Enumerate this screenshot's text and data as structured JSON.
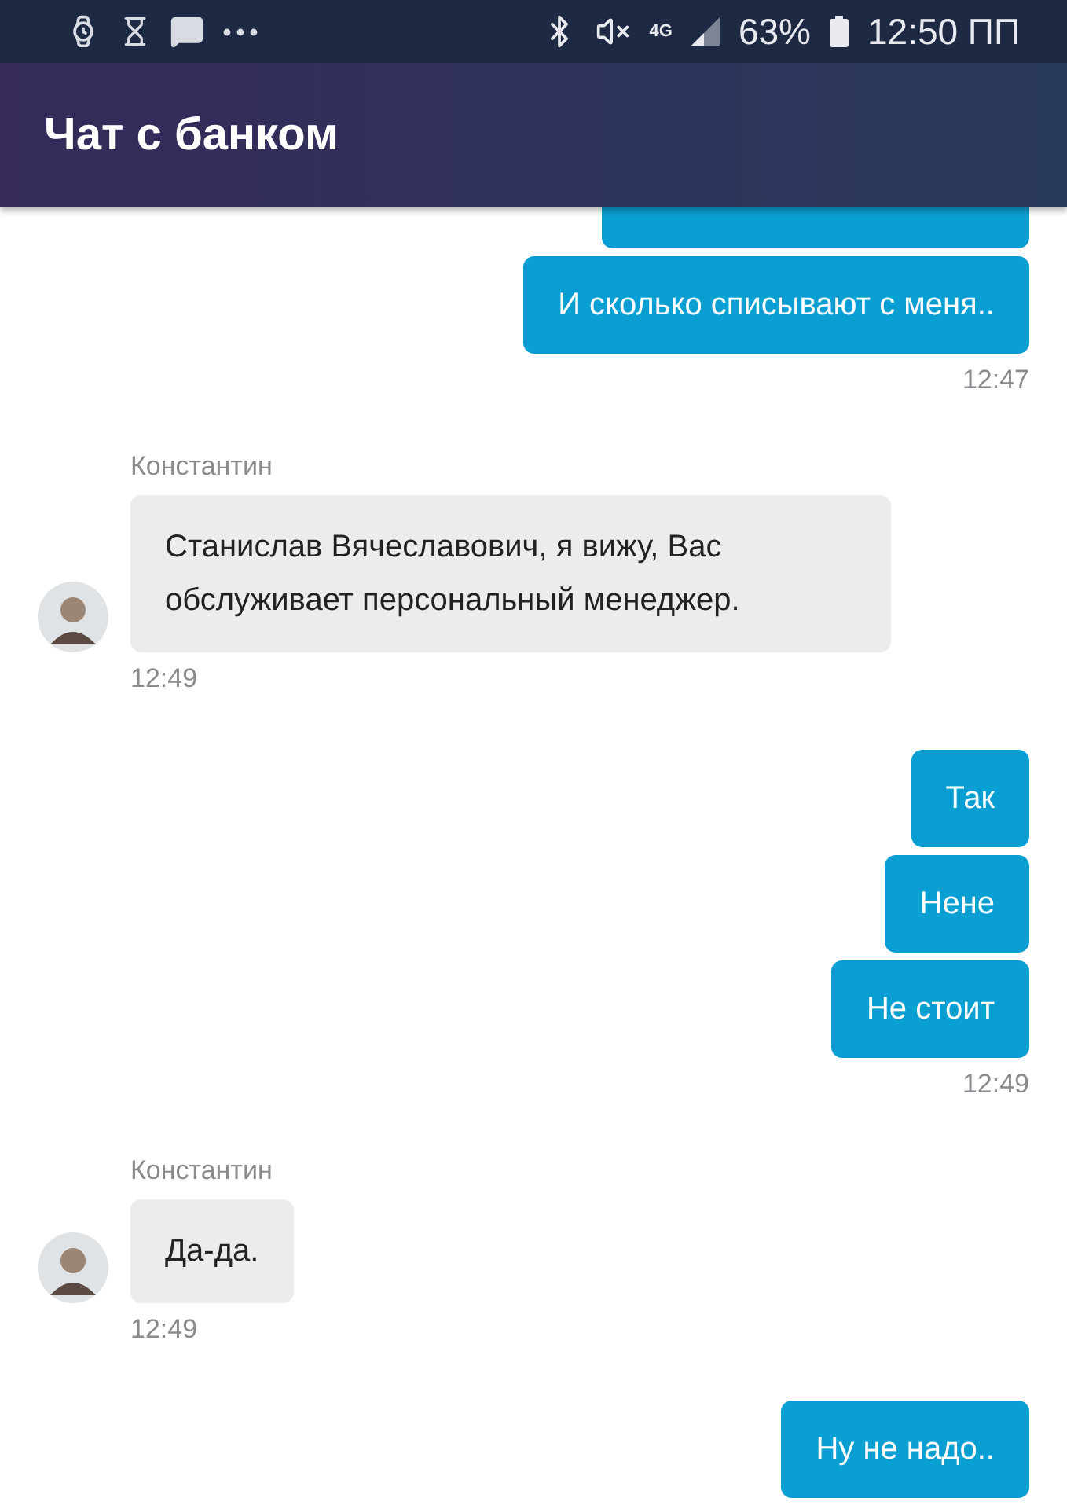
{
  "status_bar": {
    "network": "4G",
    "battery": "63%",
    "time": "12:50 ПП"
  },
  "title": "Чат с банком",
  "messages": [
    {
      "kind": "outgoing",
      "clipped_bubble": true,
      "bubbles": [
        "И сколько списывают с меня.."
      ],
      "time": "12:47"
    },
    {
      "kind": "incoming",
      "sender": "Константин",
      "bubbles": [
        "Станислав Вячеславович, я вижу, Вас обслуживает персональный менеджер."
      ],
      "time": "12:49"
    },
    {
      "kind": "outgoing",
      "bubbles": [
        "Так",
        "Нене",
        "Не стоит"
      ],
      "time": "12:49"
    },
    {
      "kind": "incoming",
      "sender": "Константин",
      "bubbles": [
        "Да-да."
      ],
      "time": "12:49"
    },
    {
      "kind": "outgoing",
      "bubbles": [
        "Ну не надо.."
      ]
    }
  ]
}
